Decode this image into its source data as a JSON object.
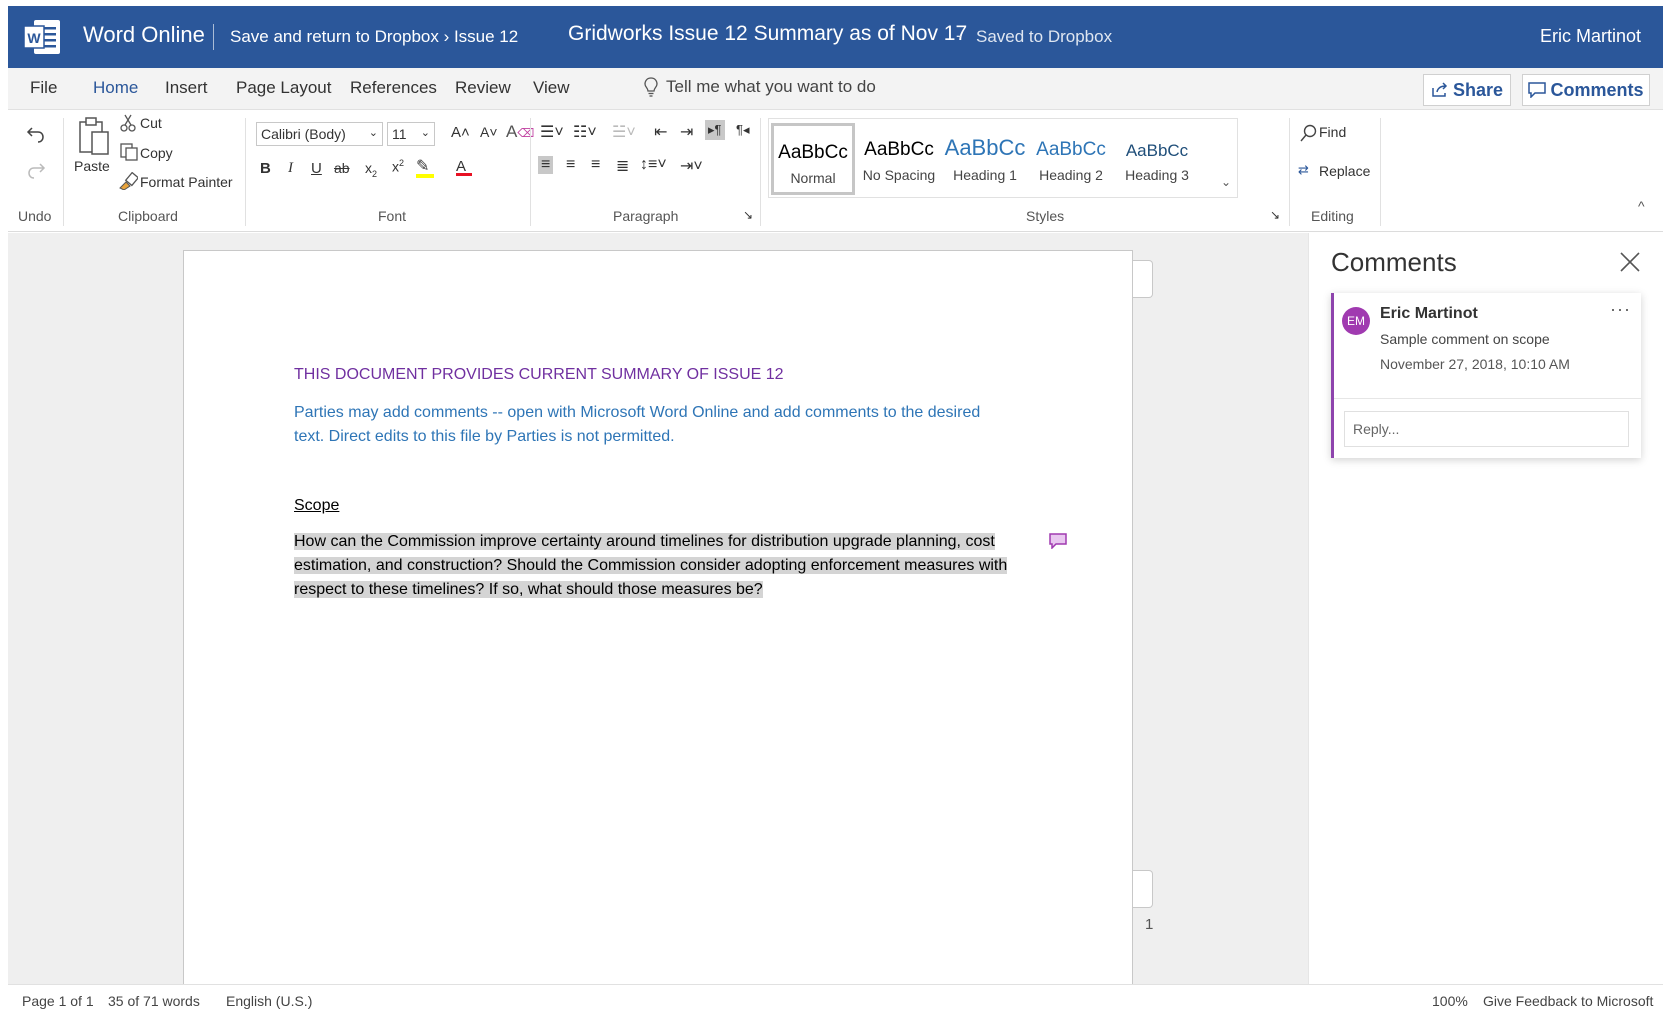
{
  "titlebar": {
    "app_name": "Word Online",
    "save_return": "Save and return to Dropbox › Issue 12",
    "doc_title": "Gridworks Issue 12 Summary as of Nov 17",
    "separator": "-",
    "save_status": "Saved to Dropbox",
    "user_name": "Eric Martinot",
    "brand_color": "#2b579a"
  },
  "menu": {
    "tabs": [
      {
        "label": "File"
      },
      {
        "label": "Home"
      },
      {
        "label": "Insert"
      },
      {
        "label": "Page Layout"
      },
      {
        "label": "References"
      },
      {
        "label": "Review"
      },
      {
        "label": "View"
      }
    ],
    "tell_me": "Tell me what you want to do",
    "share_label": "Share",
    "comments_label": "Comments"
  },
  "ribbon": {
    "undo_label": "Undo",
    "clipboard": {
      "paste": "Paste",
      "cut": "Cut",
      "copy": "Copy",
      "format_painter": "Format Painter",
      "group_label": "Clipboard"
    },
    "font": {
      "font_name": "Calibri (Body)",
      "font_size": "11",
      "group_label": "Font"
    },
    "paragraph": {
      "group_label": "Paragraph"
    },
    "styles": {
      "group_label": "Styles",
      "items": [
        {
          "sample": "AaBbCc",
          "name": "Normal"
        },
        {
          "sample": "AaBbCc",
          "name": "No Spacing"
        },
        {
          "sample": "AaBbCc",
          "name": "Heading 1"
        },
        {
          "sample": "AaBbCc",
          "name": "Heading 2"
        },
        {
          "sample": "AaBbCc",
          "name": "Heading 3"
        }
      ]
    },
    "editing": {
      "find": "Find",
      "replace": "Replace",
      "group_label": "Editing"
    }
  },
  "document": {
    "heading": "THIS DOCUMENT PROVIDES CURRENT SUMMARY OF ISSUE 12",
    "notice": "Parties may add comments -- open with Microsoft Word Online and add comments to the desired text. Direct edits to this file by Parties is not permitted.",
    "section_title": "Scope",
    "body": "How can the Commission improve certainty around timelines for distribution upgrade planning, cost estimation, and construction? Should the Commission consider adopting enforcement measures with respect to these timelines? If so, what should those measures be?",
    "page_number": "1",
    "heading_color": "#7030a0",
    "notice_color": "#2e75b6"
  },
  "comments_pane": {
    "title": "Comments",
    "comment": {
      "initials": "EM",
      "author": "Eric Martinot",
      "more": "···",
      "text": "Sample comment on scope",
      "date": "November 27, 2018, 10:10 AM"
    },
    "reply_placeholder": "Reply..."
  },
  "statusbar": {
    "page": "Page 1 of 1",
    "words": "35 of 71 words",
    "language": "English (U.S.)",
    "zoom": "100%",
    "feedback": "Give Feedback to Microsoft"
  }
}
